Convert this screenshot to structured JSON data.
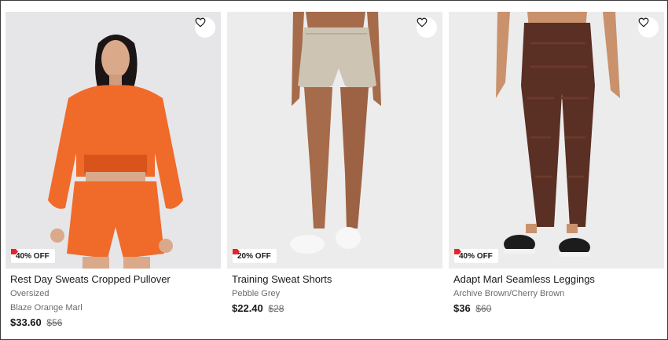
{
  "products": [
    {
      "badge": "40% OFF",
      "name": "Rest Day Sweats Cropped Pullover",
      "fit": "Oversized",
      "color": "Blaze Orange Marl",
      "price": "$33.60",
      "original_price": "$56",
      "image_colors": {
        "bg": "#e6e6e8",
        "garment": "#f06a2a",
        "shade": "#d9541a"
      }
    },
    {
      "badge": "20% OFF",
      "name": "Training Sweat Shorts",
      "color": "Pebble Grey",
      "price": "$22.40",
      "original_price": "$28",
      "image_colors": {
        "bg": "#ececec",
        "garment": "#cdc4b4",
        "skin": "#a56b4a"
      }
    },
    {
      "badge": "40% OFF",
      "name": "Adapt Marl Seamless Leggings",
      "color": "Archive Brown/Cherry Brown",
      "price": "$36",
      "original_price": "$60",
      "image_colors": {
        "bg": "#ececec",
        "garment": "#5a2f24",
        "skin": "#c9926c"
      }
    }
  ],
  "icons": {
    "favorite": "heart-outline-icon",
    "sale": "tag-icon"
  },
  "accent": {
    "sale": "#e2252b"
  }
}
